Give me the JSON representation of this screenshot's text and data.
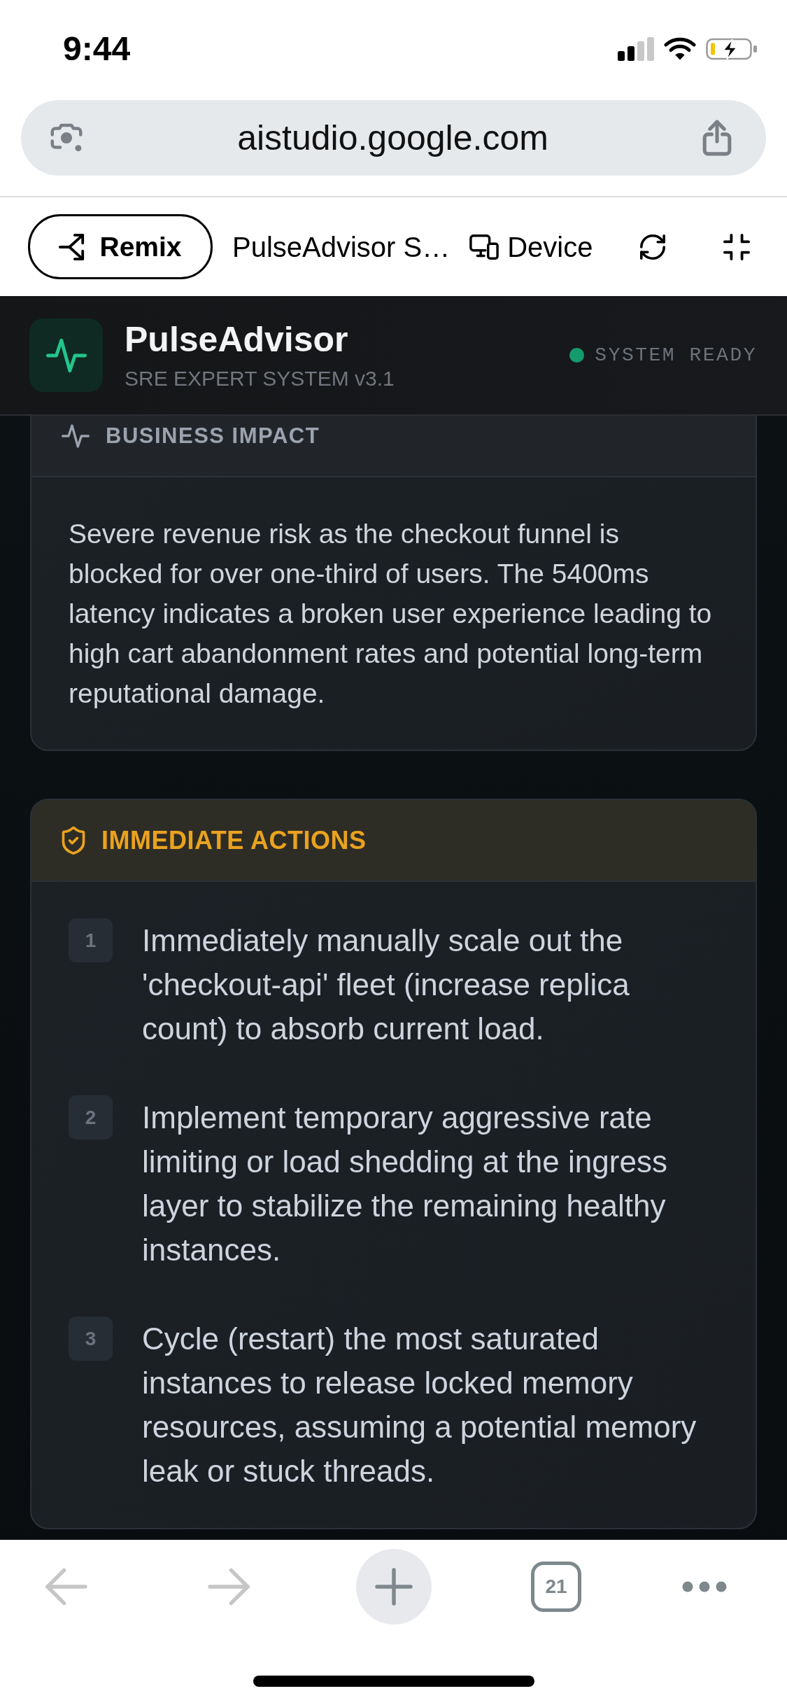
{
  "status_bar": {
    "time": "9:44"
  },
  "address_bar": {
    "url": "aistudio.google.com"
  },
  "app_toolbar": {
    "remix_button": "Remix",
    "title": "PulseAdvisor S…",
    "device_button": "Device"
  },
  "app_header": {
    "name": "PulseAdvisor",
    "subtitle": "SRE EXPERT SYSTEM v3.1",
    "status": "SYSTEM READY"
  },
  "sections": [
    {
      "kind": "impact",
      "title": "BUSINESS IMPACT",
      "body": "Severe revenue risk as the checkout funnel is blocked for over one-third of users. The 5400ms latency indicates a broken user experience leading to high cart abandonment rates and potential long-term reputational damage."
    },
    {
      "kind": "actions",
      "title": "IMMEDIATE ACTIONS",
      "items": [
        {
          "number": "1",
          "text": "Immediately manually scale out the 'checkout-api' fleet (increase replica count) to absorb current load."
        },
        {
          "number": "2",
          "text": "Implement temporary aggressive rate limiting or load shedding at the ingress layer to stabilize the remaining healthy instances."
        },
        {
          "number": "3",
          "text": "Cycle (restart) the most saturated instances to release locked memory resources, assuming a potential memory leak or stuck threads."
        }
      ]
    }
  ],
  "bottom_bar": {
    "back": {
      "disabled": true
    },
    "forward": {
      "disabled": true
    },
    "tab_count": "21"
  }
}
